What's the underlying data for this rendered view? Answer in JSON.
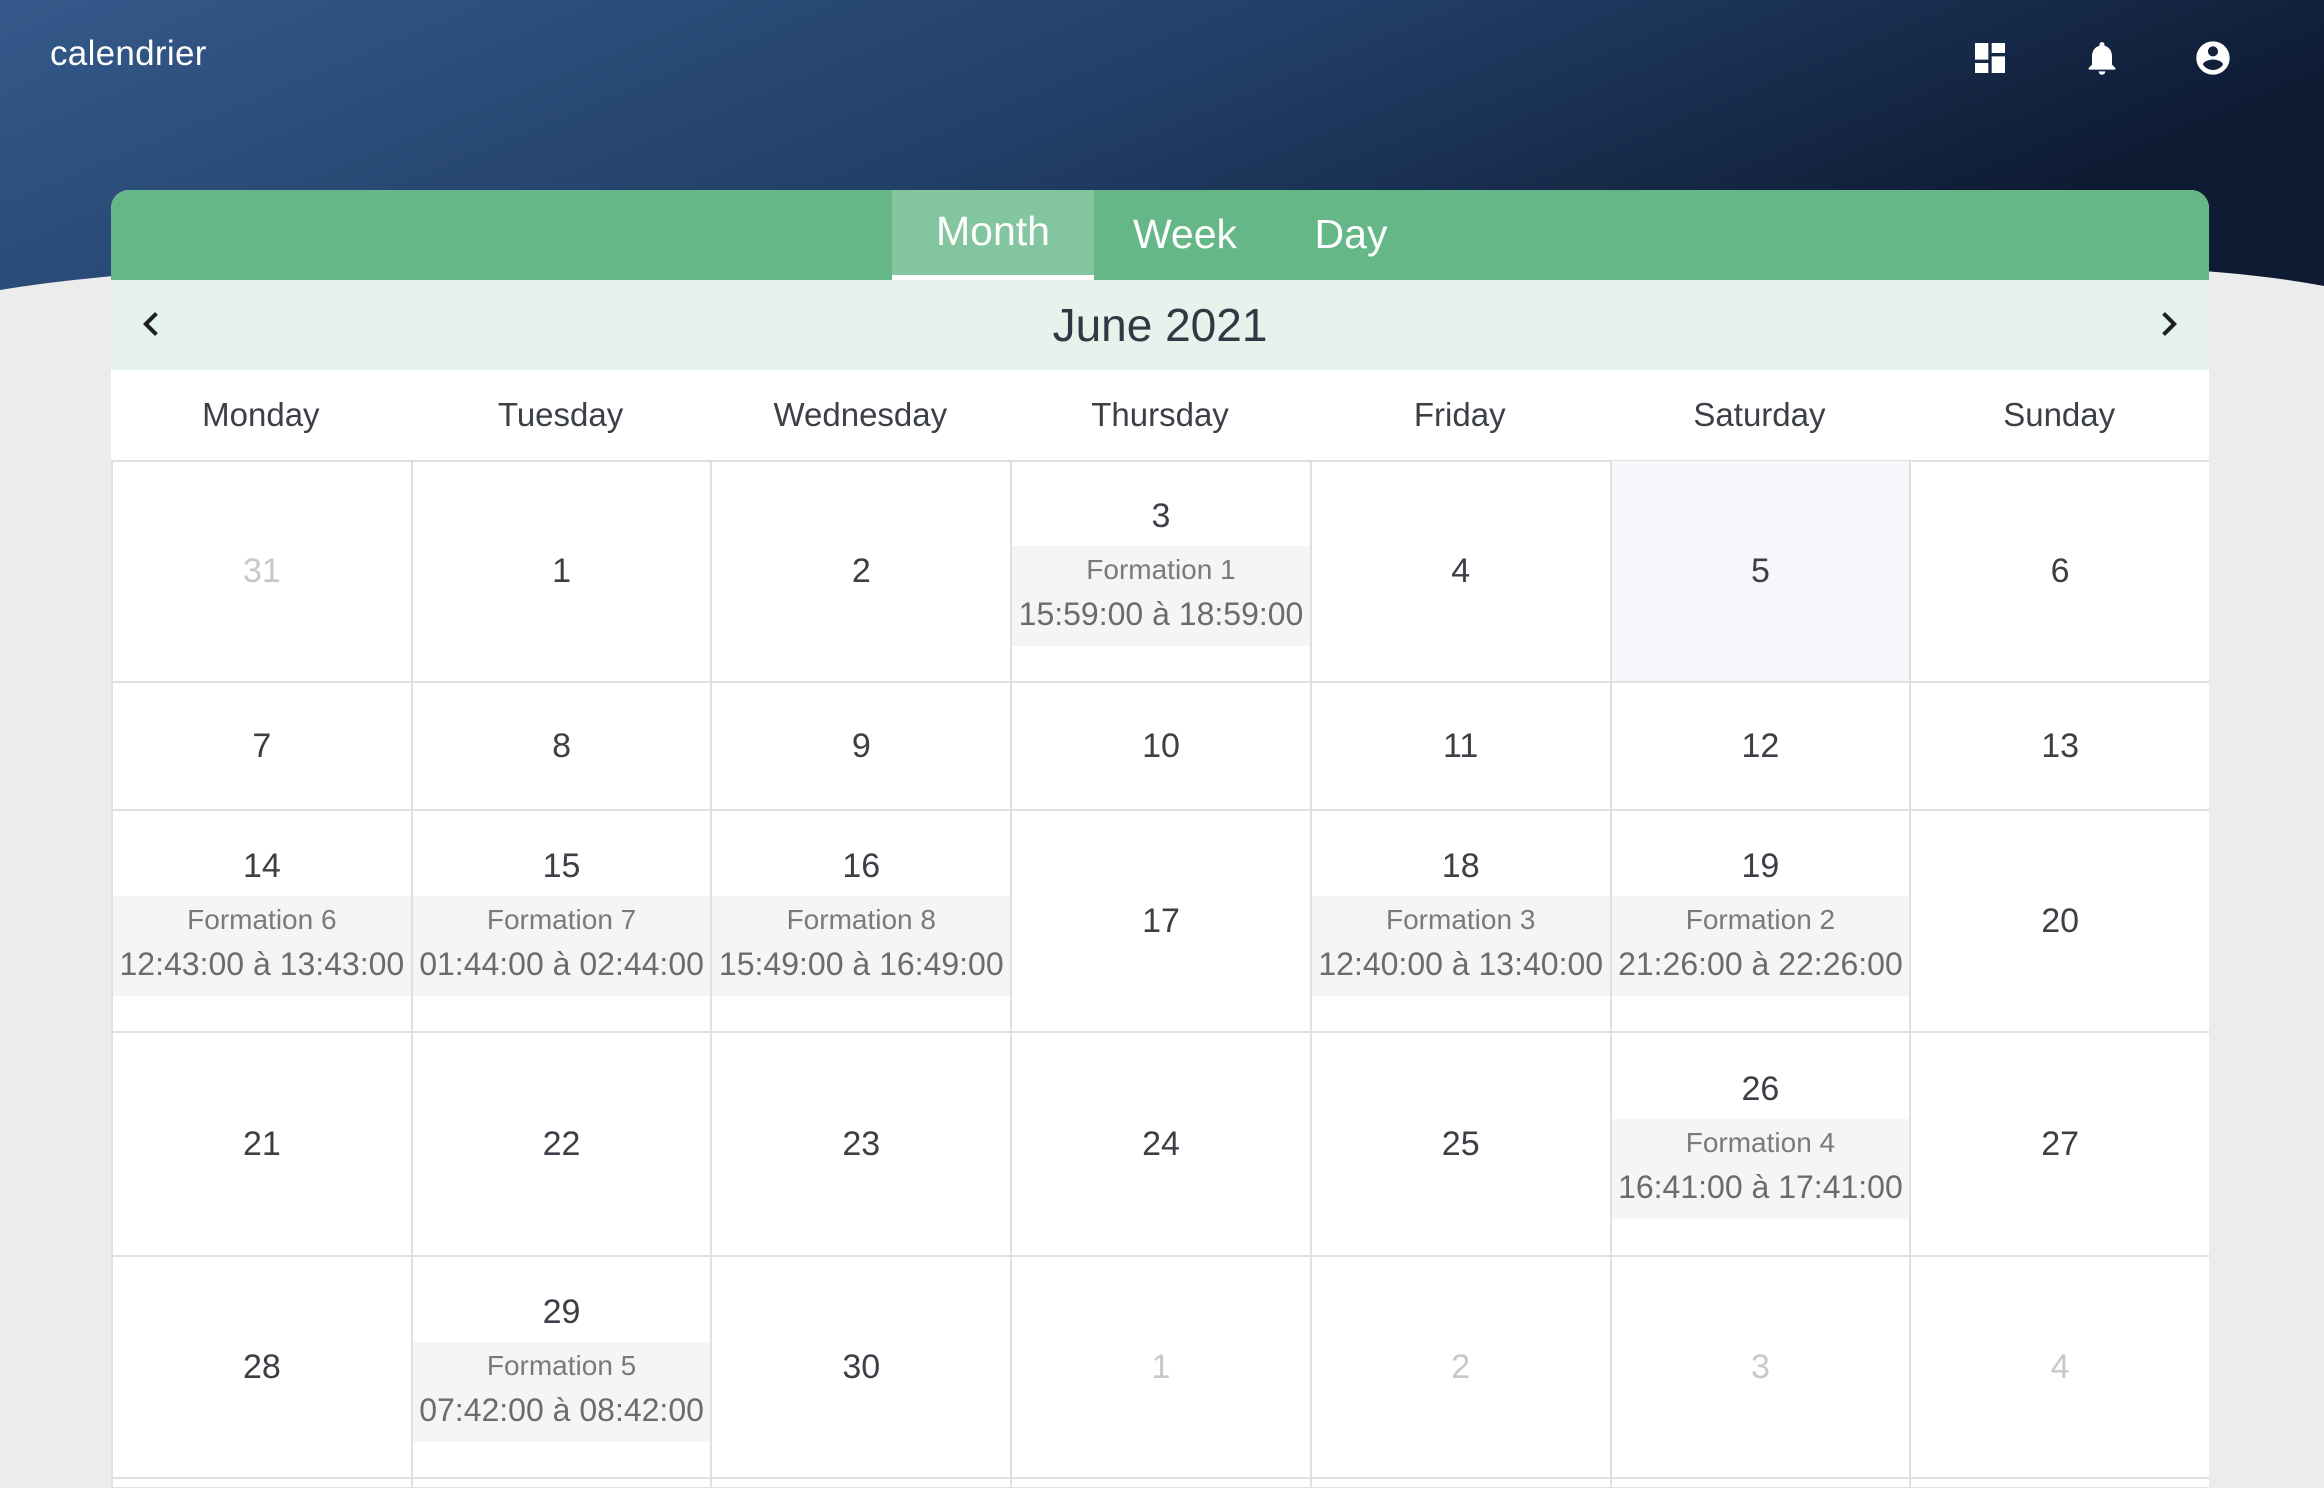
{
  "app": {
    "title": "calendrier",
    "icons": [
      "dashboard-icon",
      "bell-icon",
      "account-icon"
    ]
  },
  "colors": {
    "header_gradient_start": "#34598a",
    "header_gradient_end": "#0e1b33",
    "tab_bar": "#65b787",
    "tab_active": "#82c59e",
    "nav_bar": "#e6f3ec",
    "event_bg": "#f5f5f5",
    "today_bg": "#f7f7fb"
  },
  "tabs": [
    {
      "label": "Month",
      "active": true
    },
    {
      "label": "Week",
      "active": false
    },
    {
      "label": "Day",
      "active": false
    }
  ],
  "calendar": {
    "month_title": "June 2021",
    "weekdays": [
      "Monday",
      "Tuesday",
      "Wednesday",
      "Thursday",
      "Friday",
      "Saturday",
      "Sunday"
    ],
    "weeks": [
      [
        {
          "day": "31",
          "other": true
        },
        {
          "day": "1"
        },
        {
          "day": "2"
        },
        {
          "day": "3",
          "event": {
            "title": "Formation 1",
            "time": "15:59:00 à 18:59:00"
          }
        },
        {
          "day": "4"
        },
        {
          "day": "5",
          "today": true
        },
        {
          "day": "6"
        }
      ],
      [
        {
          "day": "7"
        },
        {
          "day": "8"
        },
        {
          "day": "9"
        },
        {
          "day": "10"
        },
        {
          "day": "11"
        },
        {
          "day": "12"
        },
        {
          "day": "13"
        }
      ],
      [
        {
          "day": "14",
          "event": {
            "title": "Formation 6",
            "time": "12:43:00 à 13:43:00"
          }
        },
        {
          "day": "15",
          "event": {
            "title": "Formation 7",
            "time": "01:44:00 à 02:44:00"
          }
        },
        {
          "day": "16",
          "event": {
            "title": "Formation 8",
            "time": "15:49:00 à 16:49:00"
          }
        },
        {
          "day": "17"
        },
        {
          "day": "18",
          "event": {
            "title": "Formation 3",
            "time": "12:40:00 à 13:40:00"
          }
        },
        {
          "day": "19",
          "event": {
            "title": "Formation 2",
            "time": "21:26:00 à 22:26:00"
          }
        },
        {
          "day": "20"
        }
      ],
      [
        {
          "day": "21"
        },
        {
          "day": "22"
        },
        {
          "day": "23"
        },
        {
          "day": "24"
        },
        {
          "day": "25"
        },
        {
          "day": "26",
          "event": {
            "title": "Formation 4",
            "time": "16:41:00 à 17:41:00"
          }
        },
        {
          "day": "27"
        }
      ],
      [
        {
          "day": "28"
        },
        {
          "day": "29",
          "event": {
            "title": "Formation 5",
            "time": "07:42:00 à 08:42:00"
          }
        },
        {
          "day": "30"
        },
        {
          "day": "1",
          "other": true
        },
        {
          "day": "2",
          "other": true
        },
        {
          "day": "3",
          "other": true
        },
        {
          "day": "4",
          "other": true
        }
      ],
      [
        {
          "day": ""
        },
        {
          "day": ""
        },
        {
          "day": ""
        },
        {
          "day": ""
        },
        {
          "day": ""
        },
        {
          "day": ""
        },
        {
          "day": ""
        }
      ]
    ]
  }
}
